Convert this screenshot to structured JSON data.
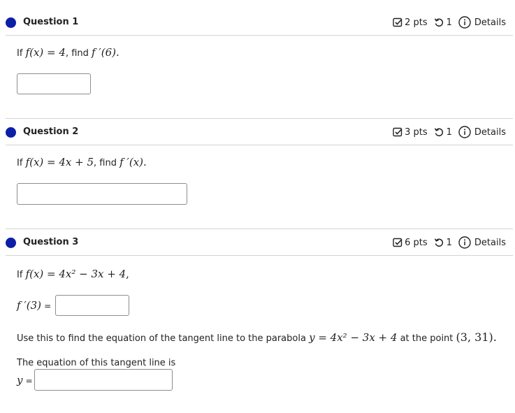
{
  "questions": [
    {
      "title": "Question 1",
      "points": "2 pts",
      "attempts": "1",
      "details": "Details",
      "prompt_pre": "If",
      "prompt_fx": "f(x) = 4",
      "prompt_mid": ", find",
      "prompt_target": "f ′(6)",
      "prompt_end": "."
    },
    {
      "title": "Question 2",
      "points": "3 pts",
      "attempts": "1",
      "details": "Details",
      "prompt_pre": "If",
      "prompt_fx": "f(x) = 4x + 5",
      "prompt_mid": ", find",
      "prompt_target": "f ′(x)",
      "prompt_end": "."
    },
    {
      "title": "Question 3",
      "points": "6 pts",
      "attempts": "1",
      "details": "Details",
      "prompt_pre": "If",
      "prompt_fx": "f(x) = 4x² − 3x + 4",
      "prompt_end": ",",
      "deriv_label": "f ′(3)",
      "equals": "=",
      "tangent_text": "Use this to find the equation of the tangent line to the parabola",
      "tangent_eq": "y = 4x² − 3x + 4",
      "at_point": "at the point",
      "point": "(3, 31).",
      "equation_label": "The equation of this tangent line is",
      "y_label": "y",
      "y_equals": "="
    }
  ],
  "colors": {
    "dot": "#0c1fa6",
    "divider": "#d3d3d3",
    "input_border": "#8d8d8d"
  },
  "icons": {
    "points": "check-square-icon",
    "attempts": "retry-icon",
    "details": "info-circle-icon"
  }
}
